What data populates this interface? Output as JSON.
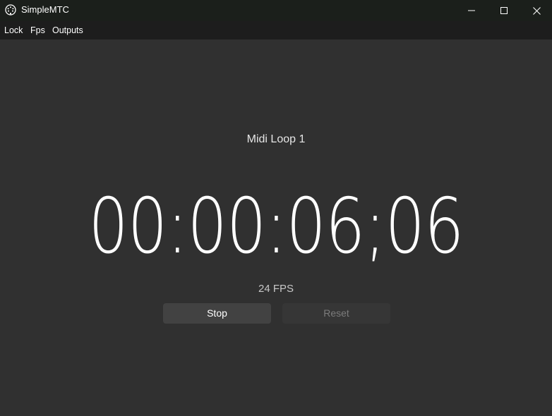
{
  "window": {
    "title": "SimpleMTC",
    "icon": "midi-din-icon",
    "controls": {
      "minimize": "minimize-icon",
      "maximize": "maximize-icon",
      "close": "close-icon"
    }
  },
  "menu": {
    "items": [
      {
        "label": "Lock"
      },
      {
        "label": "Fps"
      },
      {
        "label": "Outputs"
      }
    ]
  },
  "main": {
    "source": "Midi Loop 1",
    "timecode": "00:00:06;06",
    "fps": "24 FPS",
    "stop_label": "Stop",
    "reset_label": "Reset"
  },
  "colors": {
    "background": "#303030",
    "titlebar": "#1b1f1b",
    "menubar": "#1d1d1d",
    "button": "#424242",
    "button_disabled": "#363636"
  }
}
